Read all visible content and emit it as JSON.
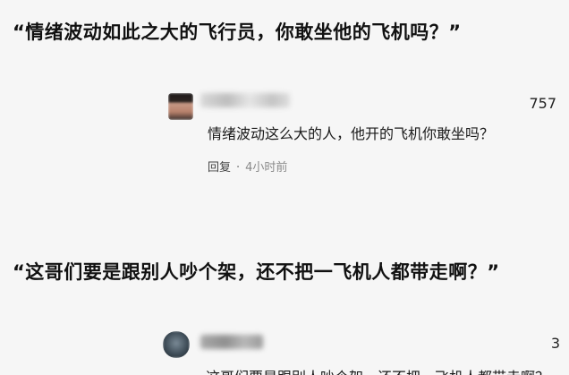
{
  "quotes": [
    "“情绪波动如此之大的飞行员，你敢坐他的飞机吗？”",
    "“这哥们要是跟别人吵个架，还不把一飞机人都带走啊？”"
  ],
  "comments": [
    {
      "likes": "757",
      "text": "情绪波动这么大的人，他开的飞机你敢坐吗？",
      "reply_label": "回复",
      "separator": "·",
      "time": "4小时前"
    },
    {
      "likes": "3",
      "text": "这哥们要是跟别人吵个架，还不把一飞机人都带走啊？"
    }
  ],
  "icons": {
    "avatar_1": "user-avatar-icon",
    "avatar_2": "user-avatar-icon"
  }
}
